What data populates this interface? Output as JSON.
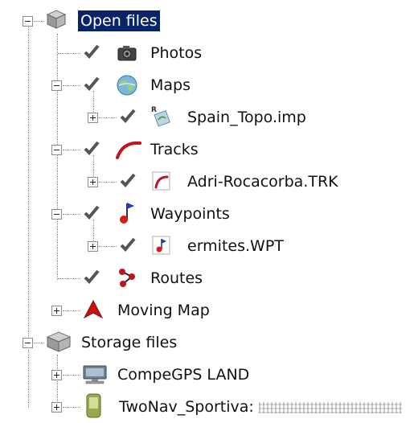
{
  "tree": {
    "open_files": {
      "label": "Open files",
      "children": {
        "photos": "Photos",
        "maps": "Maps",
        "maps_file": "Spain_Topo.imp",
        "tracks": "Tracks",
        "tracks_file": "Adri-Rocacorba.TRK",
        "waypoints": "Waypoints",
        "waypoints_file": "ermites.WPT",
        "routes": "Routes"
      }
    },
    "moving_map": "Moving Map",
    "storage_files": {
      "label": "Storage files",
      "children": {
        "compegps": "CompeGPS LAND",
        "twonav": "TwoNav_Sportiva:"
      }
    }
  },
  "colors": {
    "selection": "#0a246a",
    "check": "#5a5a5a",
    "track_red": "#c0141c",
    "arrow_red": "#cc1010"
  }
}
